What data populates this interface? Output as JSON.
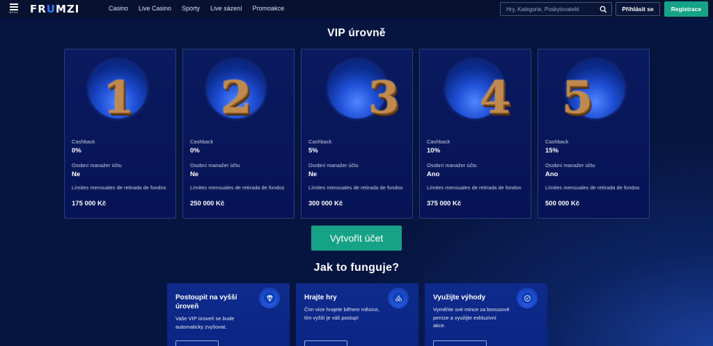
{
  "header": {
    "menu_label": "MENU",
    "logo_prefix": "FR",
    "logo_accent": "U",
    "logo_suffix": "MZI",
    "nav": [
      "Casino",
      "Live Casino",
      "Sporty",
      "Live sázení",
      "Promoakce"
    ],
    "search_placeholder": "Hry, Kategorie, Poskytovatelé",
    "login_label": "Přihlásit se",
    "register_label": "Registrace"
  },
  "vip": {
    "title": "VIP úrovně",
    "levels": [
      {
        "number": "1",
        "cashback_label": "Cashback",
        "cashback": "0%",
        "manager_label": "Osobní manažer účtu",
        "manager": "Ne",
        "limit_label": "Límites mensuales de retirada de fondos",
        "limit": "175 000 Kč"
      },
      {
        "number": "2",
        "cashback_label": "Cashback",
        "cashback": "0%",
        "manager_label": "Osobní manažer účtu",
        "manager": "Ne",
        "limit_label": "Límites mensuales de retirada de fondos",
        "limit": "250 000 Kč"
      },
      {
        "number": "3",
        "cashback_label": "Cashback",
        "cashback": "5%",
        "manager_label": "Osobní manažer účtu",
        "manager": "Ne",
        "limit_label": "Límites mensuales de retirada de fondos",
        "limit": "300 000 Kč"
      },
      {
        "number": "4",
        "cashback_label": "Cashback",
        "cashback": "10%",
        "manager_label": "Osobní manažer účtu",
        "manager": "Ano",
        "limit_label": "Límites mensuales de retirada de fondos",
        "limit": "375 000 Kč"
      },
      {
        "number": "5",
        "cashback_label": "Cashback",
        "cashback": "15%",
        "manager_label": "Osobní manažer účtu",
        "manager": "Ano",
        "limit_label": "Límites mensuales de retirada de fondos",
        "limit": "500 000 Kč"
      }
    ],
    "cta_label": "Vytvořit účet"
  },
  "how": {
    "title": "Jak to funguje?",
    "steps": [
      {
        "title": "Postoupit na vyšší úroveň",
        "text": "Vaše VIP úroveň se bude automaticky zvyšovat.",
        "icon": "diamond-icon"
      },
      {
        "title": "Hrajte hry",
        "text": "Čím více hrajete během měsíce, tím vyšší je váš postup!",
        "icon": "cherries-icon"
      },
      {
        "title": "Využijte výhody",
        "text": "Vyměňte své mince za bonusové peníze a využijte exkluzivní akce.",
        "icon": "coin-icon"
      }
    ]
  },
  "colors": {
    "accent_green": "#16a286",
    "background": "#061540",
    "header": "#071231",
    "gold_number": "#c08a4e"
  }
}
